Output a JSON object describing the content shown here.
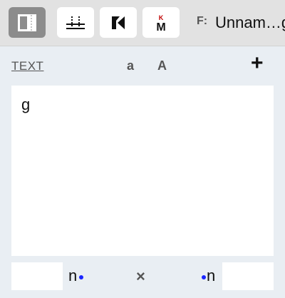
{
  "toolbar": {
    "buttons": [
      {
        "icon": "sidebar-panel-icon",
        "active": true
      },
      {
        "icon": "metrics-ruler-icon",
        "active": false
      },
      {
        "icon": "kerning-k-icon",
        "active": false
      },
      {
        "icon": "km-glyph-icon",
        "active": false,
        "glyph_top": "K",
        "glyph_bottom": "M"
      }
    ],
    "file_label": "F:",
    "file_name": "Unnam…g"
  },
  "text_bar": {
    "tab_label": "TEXT",
    "lowercase_label": "a",
    "uppercase_label": "A",
    "add_label": "+"
  },
  "editor": {
    "content": "g"
  },
  "bottom_bar": {
    "left_glyph": "n",
    "right_glyph": "n",
    "swap_label": "×",
    "dot_color": "#1a25ff"
  }
}
